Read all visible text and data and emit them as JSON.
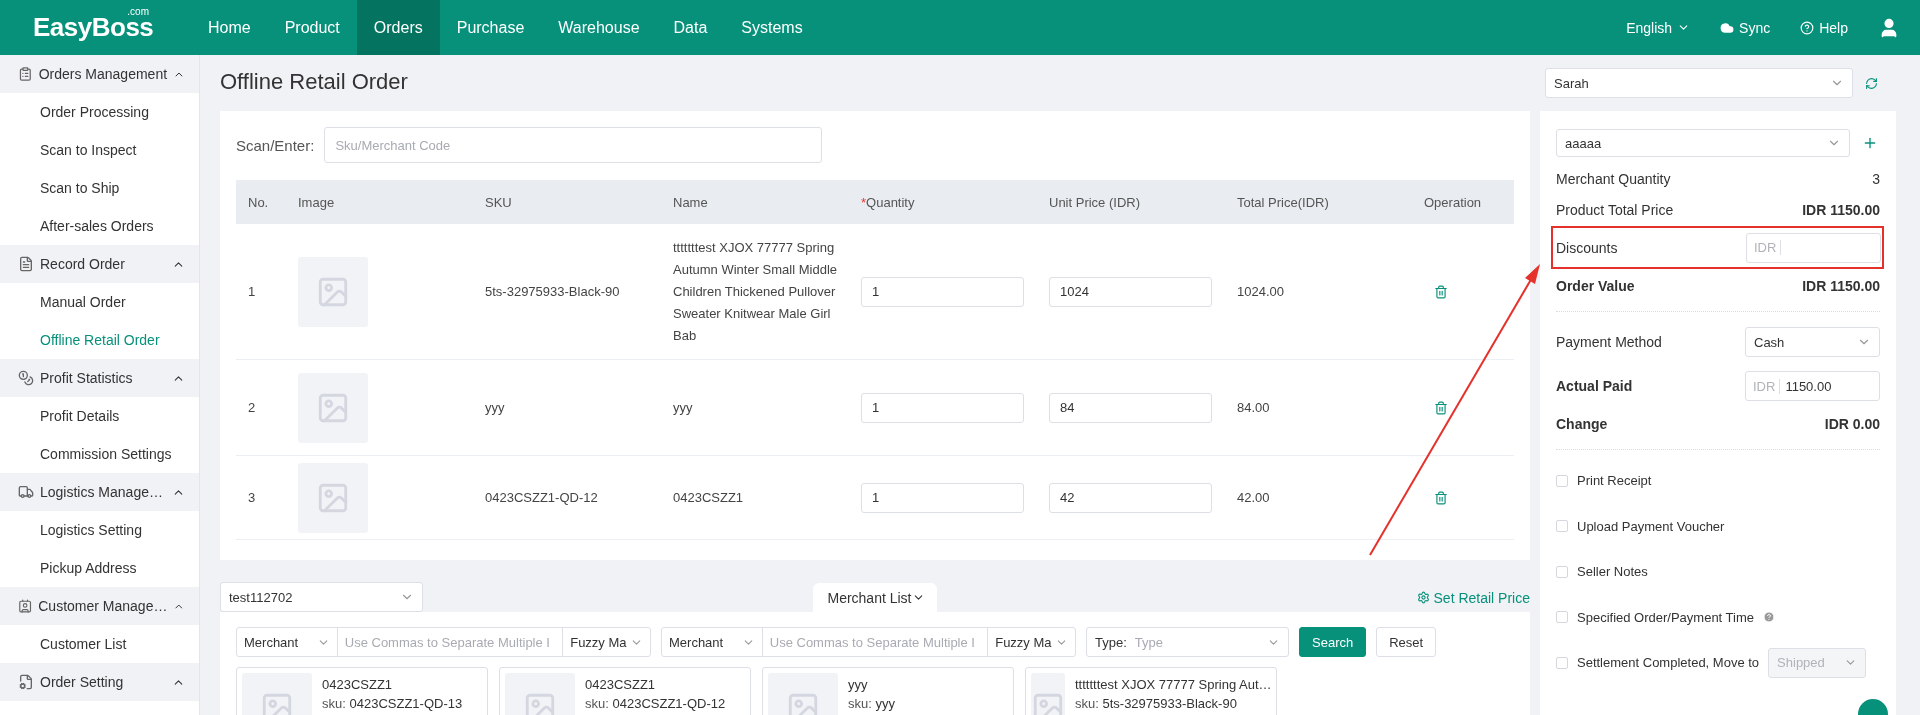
{
  "brand": {
    "name": "EasyBoss",
    "suffix": ".com"
  },
  "nav": [
    {
      "label": "Home",
      "selected": false
    },
    {
      "label": "Product",
      "selected": false
    },
    {
      "label": "Orders",
      "selected": true
    },
    {
      "label": "Purchase",
      "selected": false
    },
    {
      "label": "Warehouse",
      "selected": false
    },
    {
      "label": "Data",
      "selected": false
    },
    {
      "label": "Systems",
      "selected": false
    }
  ],
  "header_actions": {
    "language": "English",
    "sync": "Sync",
    "help": "Help"
  },
  "sidebar": [
    {
      "label": "Orders Management",
      "expanded": true,
      "children": [
        {
          "label": "Order Processing",
          "selected": false
        },
        {
          "label": "Scan to Inspect",
          "selected": false
        },
        {
          "label": "Scan to Ship",
          "selected": false
        },
        {
          "label": "After-sales Orders",
          "selected": false
        }
      ]
    },
    {
      "label": "Record Order",
      "expanded": true,
      "children": [
        {
          "label": "Manual Order",
          "selected": false
        },
        {
          "label": "Offline Retail Order",
          "selected": true
        }
      ]
    },
    {
      "label": "Profit Statistics",
      "expanded": true,
      "children": [
        {
          "label": "Profit Details",
          "selected": false
        },
        {
          "label": "Commission Settings",
          "selected": false
        }
      ]
    },
    {
      "label": "Logistics Manage…",
      "expanded": true,
      "children": [
        {
          "label": "Logistics Setting",
          "selected": false
        },
        {
          "label": "Pickup Address",
          "selected": false
        }
      ]
    },
    {
      "label": "Customer Manage…",
      "expanded": true,
      "children": [
        {
          "label": "Customer List",
          "selected": false
        }
      ]
    },
    {
      "label": "Order Setting",
      "expanded": true
    }
  ],
  "page_title": "Offline Retail Order",
  "scan": {
    "label": "Scan/Enter:",
    "placeholder": "Sku/Merchant Code"
  },
  "table": {
    "columns": [
      {
        "label": "No."
      },
      {
        "label": "Image"
      },
      {
        "label": "SKU"
      },
      {
        "label": "Name"
      },
      {
        "label": "Quantity",
        "required_mark": "*"
      },
      {
        "label": "Unit Price (IDR)"
      },
      {
        "label": "Total Price(IDR)"
      },
      {
        "label": "Operation"
      }
    ],
    "rows": [
      {
        "no": "1",
        "sku": "5ts-32975933-Black-90",
        "name": "tttttttest XJOX 77777 Spring Autumn Winter Small Middle Children Thickened Pullover Sweater Knitwear Male Girl Bab",
        "quantity": "1",
        "unit_price": "1024",
        "total": "1024.00"
      },
      {
        "no": "2",
        "sku": "yyy",
        "name": "yyy",
        "quantity": "1",
        "unit_price": "84",
        "total": "84.00"
      },
      {
        "no": "3",
        "sku": "0423CSZZ1-QD-12",
        "name": "0423CSZZ1",
        "quantity": "1",
        "unit_price": "42",
        "total": "42.00"
      }
    ]
  },
  "warehouse_select": "test112702",
  "merchant_tab": "Merchant List",
  "set_retail_price": "Set Retail Price",
  "filters": [
    {
      "field": "Merchant",
      "placeholder": "Use Commas to Separate Multiple I",
      "match": "Fuzzy Ma"
    },
    {
      "field": "Merchant",
      "placeholder": "Use Commas to Separate Multiple I",
      "match": "Fuzzy Ma"
    }
  ],
  "type_filter": {
    "label": "Type:",
    "placeholder": "Type"
  },
  "filter_buttons": {
    "search": "Search",
    "reset": "Reset"
  },
  "products": [
    {
      "name": "0423CSZZ1",
      "sku_label": "sku:",
      "sku": "0423CSZZ1-QD-13"
    },
    {
      "name": "0423CSZZ1",
      "sku_label": "sku:",
      "sku": "0423CSZZ1-QD-12"
    },
    {
      "name": "yyy",
      "sku_label": "sku:",
      "sku": "yyy"
    },
    {
      "name": "tttttttest XJOX 77777 Spring Aut…",
      "sku_label": "sku:",
      "sku": "5ts-32975933-Black-90"
    }
  ],
  "seller_select": "Sarah",
  "customer_select": "aaaaa",
  "summary": [
    {
      "kind": "value",
      "label": "Merchant Quantity",
      "value": "3",
      "label_bold": false,
      "value_bold": false,
      "highlighted": false
    },
    {
      "kind": "value",
      "label": "Product Total Price",
      "value": "IDR 1150.00",
      "label_bold": false,
      "value_bold": true,
      "highlighted": false
    },
    {
      "kind": "input",
      "label": "Discounts",
      "prefix": "IDR",
      "label_bold": false,
      "highlighted": true
    },
    {
      "kind": "value",
      "label": "Order Value",
      "value": "IDR 1150.00",
      "label_bold": true,
      "value_bold": true,
      "highlighted": false
    },
    {
      "kind": "divider"
    },
    {
      "kind": "select",
      "label": "Payment Method",
      "value": "Cash",
      "label_bold": false,
      "highlighted": false
    },
    {
      "kind": "input",
      "label": "Actual Paid",
      "prefix": "IDR",
      "value": "1150.00",
      "label_bold": true,
      "highlighted": false
    },
    {
      "kind": "value",
      "label": "Change",
      "value": "IDR 0.00",
      "label_bold": true,
      "value_bold": true,
      "highlighted": false
    },
    {
      "kind": "divider"
    }
  ],
  "options": [
    {
      "label": "Print Receipt",
      "checked": false
    },
    {
      "label": "Upload Payment Voucher",
      "checked": false
    },
    {
      "label": "Seller Notes",
      "checked": false
    },
    {
      "label": "Specified Order/Payment Time",
      "checked": false,
      "help": true
    },
    {
      "label": "Settlement Completed, Move to",
      "checked": false,
      "select": {
        "value": "Shipped",
        "disabled": true
      }
    }
  ]
}
